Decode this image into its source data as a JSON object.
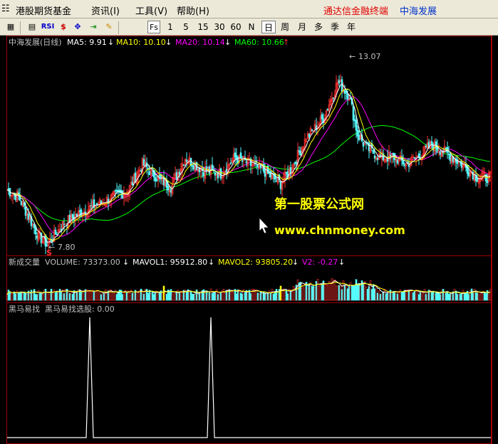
{
  "menu": {
    "items": [
      "港股期货基金",
      "资讯(I)",
      "工具(V)",
      "帮助(H)"
    ],
    "app_name": "通达信金融终端",
    "stock_name": "中海发展"
  },
  "toolbar": {
    "icons": [
      "grid-icon",
      "chart-icon",
      "rsi-icon",
      "dollar-icon",
      "move-icon",
      "export-icon",
      "pencil-icon"
    ],
    "rsi_label": "RSI",
    "fs_label": "Fs",
    "periods": [
      "1",
      "5",
      "15",
      "30",
      "60",
      "N",
      "日",
      "周",
      "月",
      "多",
      "季",
      "年"
    ],
    "active_period": "日"
  },
  "price_panel": {
    "title": "中海发展(日线)",
    "ma5": "MA5: 9.91",
    "ma10": "MA10: 10.10",
    "ma20": "MA20: 10.14",
    "ma60": "MA60: 10.66",
    "high_label": "13.07",
    "low_label": "7.80",
    "low_marker": "S",
    "watermark_title": "第一股票公式网",
    "watermark_url": "www.chnmoney.com",
    "colors": {
      "ma5": "#ffffff",
      "ma10": "#ffff00",
      "ma20": "#ff00ff",
      "ma60": "#00ff00",
      "up": "#ff3232",
      "down": "#54fcfc"
    }
  },
  "volume_panel": {
    "title": "新成交量",
    "volume": "VOLUME: 73373.00",
    "mavol1": "MAVOL1: 95912.80",
    "mavol2": "MAVOL2: 93805.20",
    "v2": "V2: -0.27"
  },
  "indicator_panel": {
    "title": "黑马易找",
    "value": "黑马易找选股: 0.00"
  }
}
